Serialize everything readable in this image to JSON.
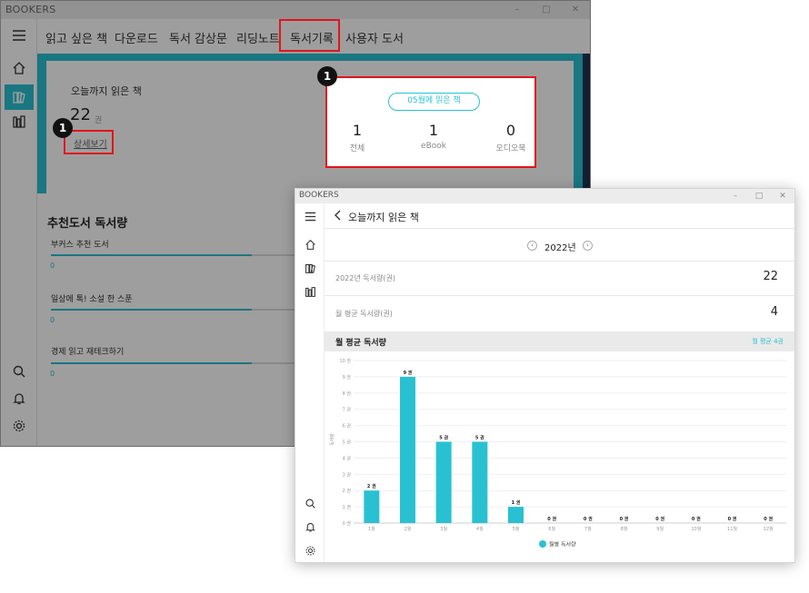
{
  "back_window": {
    "app_title": "BOOKERS",
    "window_controls": [
      "–",
      "□",
      "✕"
    ],
    "menu_tabs": [
      "읽고 싶은 책",
      "다운로드",
      "독서 감상문",
      "리딩노트",
      "독서기록",
      "사용자 도서"
    ],
    "active_tab_index": 4,
    "total_read": {
      "label": "오늘까지 읽은 책",
      "value": "22",
      "unit": "권",
      "detail_link": "상세보기"
    },
    "month_stats": {
      "pill_label": "05월에 읽은 책",
      "stats": [
        {
          "value": "1",
          "label": "전체"
        },
        {
          "value": "1",
          "label": "eBook"
        },
        {
          "value": "0",
          "label": "오디오북"
        }
      ]
    },
    "recommend": {
      "title": "추천도서 독서량",
      "items": [
        {
          "label": "부커스 추천 도서",
          "value": "0",
          "progress": 0.82
        },
        {
          "label": "일상에 톡! 소설 한 스푼",
          "value": "0",
          "progress": 0.82
        },
        {
          "label": "경제 읽고 재테크하기",
          "value": "0",
          "progress": 0.82
        }
      ]
    }
  },
  "annotations": {
    "badge_1": "1",
    "badge_2": "1"
  },
  "front_window": {
    "app_title": "BOOKERS",
    "window_controls": [
      "–",
      "□",
      "✕"
    ],
    "header_title": "오늘까지 읽은 책",
    "year_nav": {
      "prev": "‹",
      "year": "2022년",
      "next": "›"
    },
    "rows": [
      {
        "label": "2022년 독서량(권)",
        "value": "22"
      },
      {
        "label": "월 평균 독서량(권)",
        "value": "4"
      }
    ],
    "chart_header": {
      "title": "월 평균 독서량",
      "avg_label": "월 평균 4권"
    }
  },
  "colors": {
    "accent": "#29c1d2",
    "annotation": "#e1141b",
    "dark_strip": "#1f3553"
  },
  "chart_data": {
    "type": "bar",
    "categories": [
      "1월",
      "2월",
      "3월",
      "4월",
      "5월",
      "6월",
      "7월",
      "8월",
      "9월",
      "10월",
      "11월",
      "12월"
    ],
    "values": [
      2,
      9,
      5,
      5,
      1,
      0,
      0,
      0,
      0,
      0,
      0,
      0
    ],
    "data_labels": [
      "2 권",
      "9 권",
      "5 권",
      "5 권",
      "1 권",
      "0 권",
      "0 권",
      "0 권",
      "0 권",
      "0 권",
      "0 권",
      "0 권"
    ],
    "y_ticks": [
      "0 권",
      "1 권",
      "2 권",
      "3 권",
      "4 권",
      "5 권",
      "6 권",
      "7 권",
      "8 권",
      "9 권",
      "10 권"
    ],
    "ylabel": "독서량",
    "ylim": [
      0,
      10
    ],
    "legend": "월별 독서량",
    "legend_position": "bottom-center",
    "grid": true
  }
}
